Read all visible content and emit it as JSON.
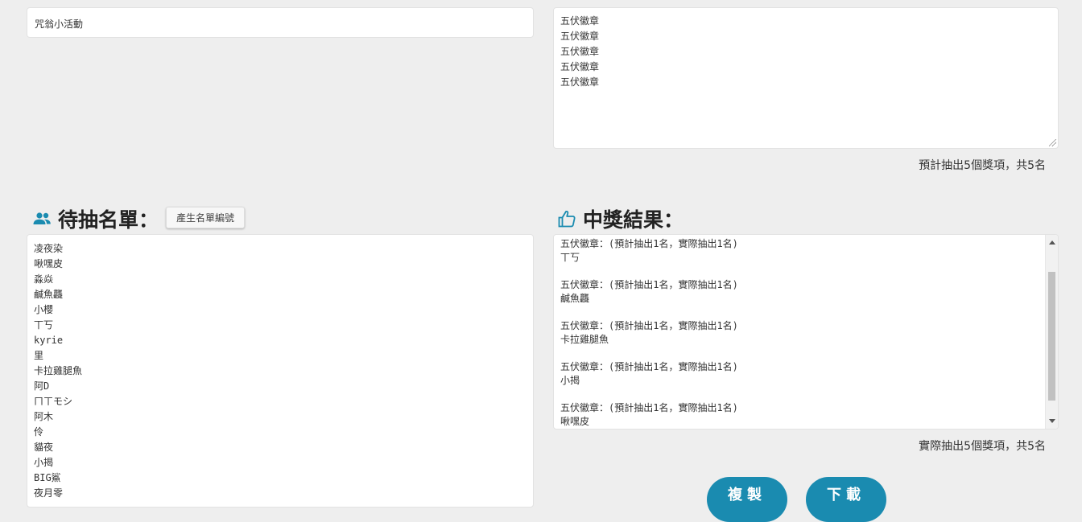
{
  "event_title": "咒翁小活動",
  "prizes": [
    "五伏徽章",
    "五伏徽章",
    "五伏徽章",
    "五伏徽章",
    "五伏徽章"
  ],
  "plan_count_text": "預計抽出5個獎項，共5名",
  "namelist_section": {
    "title": "待抽名單：",
    "icon": "people-icon",
    "generate_button": "產生名單編號"
  },
  "names": [
    "凌夜染",
    "啾嘿皮",
    "淼焱",
    "鹹魚龘",
    "小櫻",
    "丅丂",
    "kyrie",
    "里",
    "卡拉雞腿魚",
    "阿D",
    "ㄇㄒモシ",
    "阿木",
    "伶",
    "貓夜",
    "小揭",
    "BIG鯊",
    "夜月零"
  ],
  "result_section": {
    "title": "中獎結果：",
    "icon": "thumbs-up-icon"
  },
  "results": [
    {
      "header": "五伏徽章：(預計抽出1名，實際抽出1名)",
      "winner": "丅丂"
    },
    {
      "header": "五伏徽章：(預計抽出1名，實際抽出1名)",
      "winner": "鹹魚龘"
    },
    {
      "header": "五伏徽章：(預計抽出1名，實際抽出1名)",
      "winner": "卡拉雞腿魚"
    },
    {
      "header": "五伏徽章：(預計抽出1名，實際抽出1名)",
      "winner": "小揭"
    },
    {
      "header": "五伏徽章：(預計抽出1名，實際抽出1名)",
      "winner": "啾嘿皮"
    }
  ],
  "actual_count_text": "實際抽出5個獎項，共5名",
  "buttons": {
    "copy": "複製",
    "download": "下載"
  },
  "colors": {
    "accent": "#1a8bb0",
    "icon": "#1a8bb0",
    "background": "#eeeeee"
  }
}
